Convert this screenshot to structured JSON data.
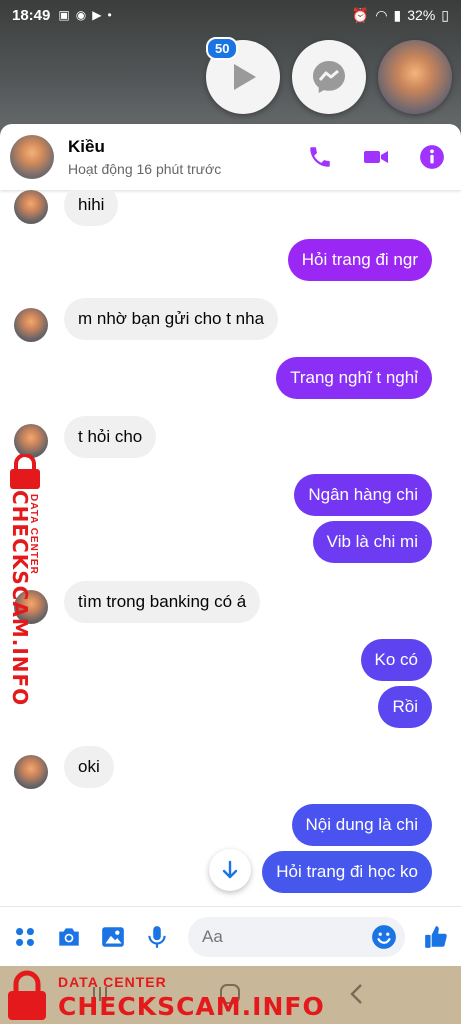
{
  "status_bar": {
    "time": "18:49",
    "battery": "32%"
  },
  "bubbles": {
    "badge_count": "50"
  },
  "header": {
    "name": "Kiều",
    "status": "Hoạt động 16 phút trước"
  },
  "messages": [
    {
      "side": "in",
      "text": "hihi"
    },
    {
      "side": "out",
      "text": "Hỏi trang đi ngr"
    },
    {
      "side": "in",
      "text": "m nhờ bạn gửi cho t nha"
    },
    {
      "side": "out",
      "text": "Trang nghĩ t nghỉ"
    },
    {
      "side": "in",
      "text": "t hỏi cho"
    },
    {
      "side": "out",
      "text": "Ngân hàng chi"
    },
    {
      "side": "out",
      "text": "Vib là chi mi"
    },
    {
      "side": "in",
      "text": "tìm trong banking có á"
    },
    {
      "side": "out",
      "text": "Ko có"
    },
    {
      "side": "out",
      "text": "Rồi"
    },
    {
      "side": "in",
      "text": "oki"
    },
    {
      "side": "out",
      "text": "Nội dung là chi"
    },
    {
      "side": "out",
      "text": "Hỏi trang đi học ko"
    }
  ],
  "composer": {
    "placeholder": "Aa"
  },
  "watermark": {
    "line1": "DATA CENTER",
    "line2": "CHECKSCAM.INFO"
  },
  "colors": {
    "accent": "#a033ff",
    "bubble_purple": "#9b27f5",
    "bubble_blue": "#5b48f0",
    "incoming": "#f0f0f0"
  }
}
